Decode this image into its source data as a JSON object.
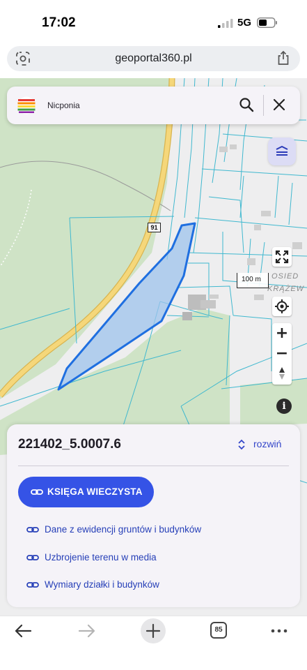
{
  "status_bar": {
    "time": "17:02",
    "network": "5G"
  },
  "browser": {
    "url": "geoportal360.pl"
  },
  "map": {
    "search": {
      "value": "Nicponia"
    },
    "road_number": "91",
    "scale_label": "100 m",
    "locality_label_1": "OSIED",
    "locality_label_2": "KRĄŻEW",
    "zoom_in_label": "+",
    "zoom_out_label": "−",
    "info_label": "i"
  },
  "parcel_panel": {
    "parcel_id": "221402_5.0007.6",
    "expand_label": "rozwiń",
    "primary_button_label": "KSIĘGA WIECZYSTA",
    "links": [
      {
        "label": "Dane z ewidencji gruntów i budynków"
      },
      {
        "label": "Uzbrojenie terenu w media"
      },
      {
        "label": "Wymiary działki i budynków"
      }
    ]
  },
  "toolbar": {
    "tabs_count": "85"
  },
  "colors": {
    "accent": "#3553e6",
    "link": "#2740b8",
    "parcel_fill": "#9ec3ec",
    "parcel_stroke": "#1f6fe0",
    "road": "#f5d77a",
    "forest": "#cfe3c6"
  }
}
